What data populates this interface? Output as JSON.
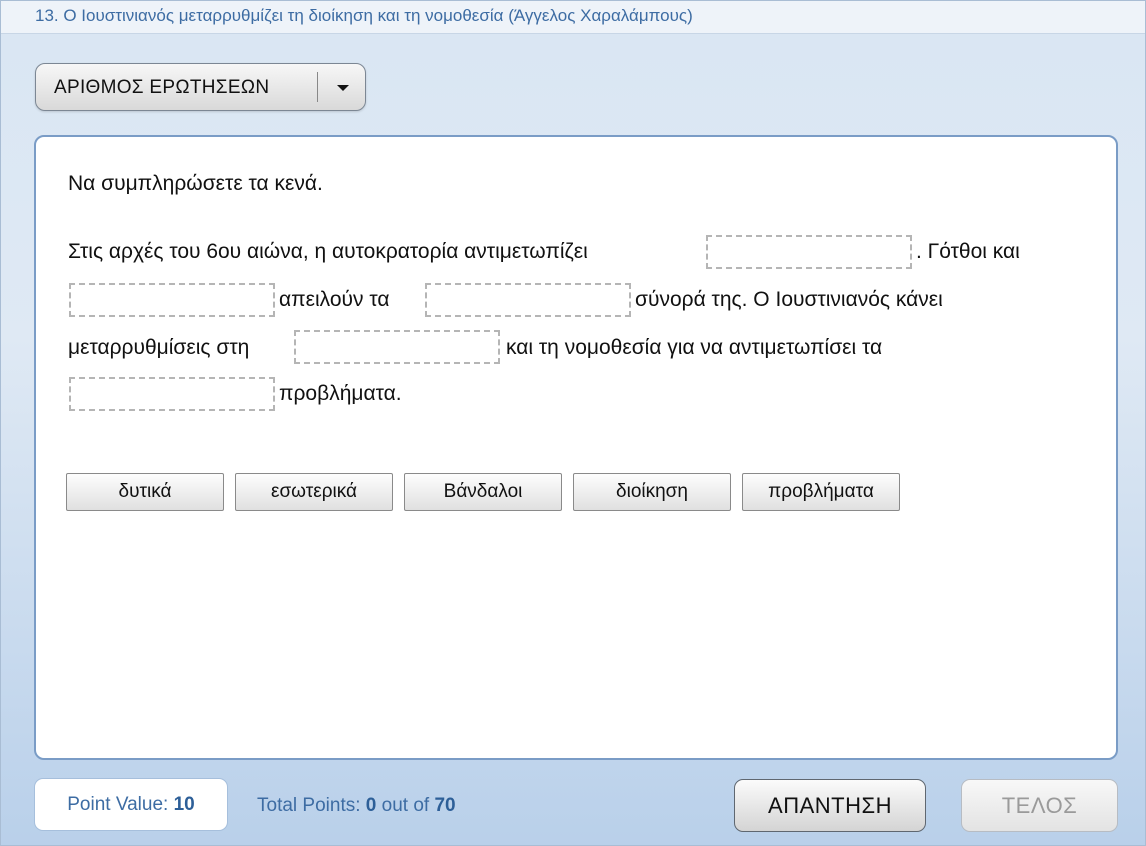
{
  "header": {
    "title": "13. Ο Ιουστινιανός μεταρρυθμίζει τη διοίκηση και τη νομοθεσία (Άγγελος Χαραλάμπους)"
  },
  "question_dropdown": {
    "label": "ΑΡΙΘΜΟΣ ΕΡΩΤΗΣΕΩΝ",
    "icon": "chevron-down-icon"
  },
  "question": {
    "instruction": "Να συμπληρώσετε τα κενά.",
    "segments": [
      "Στις αρχές του 6ου αιώνα, η αυτοκρατορία αντιμετωπίζει",
      ". Γότθοι και",
      "απειλούν τα",
      "σύνορά της. Ο Ιουστινιανός κάνει",
      "μεταρρυθμίσεις στη",
      "και τη νομοθεσία για να αντιμετωπίσει τα",
      "προβλήματα."
    ],
    "blanks": [
      "",
      "",
      "",
      "",
      ""
    ]
  },
  "word_bank": [
    "δυτικά",
    "εσωτερικά",
    "Βάνδαλοι",
    "διοίκηση",
    "προβλήματα"
  ],
  "footer": {
    "point_value_label": "Point Value:",
    "point_value": "10",
    "total_points_label": "Total Points:",
    "total_points": "0",
    "out_of_label": "out of",
    "max_points": "70",
    "answer_button": "ΑΠΑΝΤΗΣΗ",
    "end_button": "ΤΕΛΟΣ"
  },
  "colors": {
    "title_text": "#3d6ca3",
    "card_border": "#7a9cc6",
    "background": "#d9e6f3"
  }
}
